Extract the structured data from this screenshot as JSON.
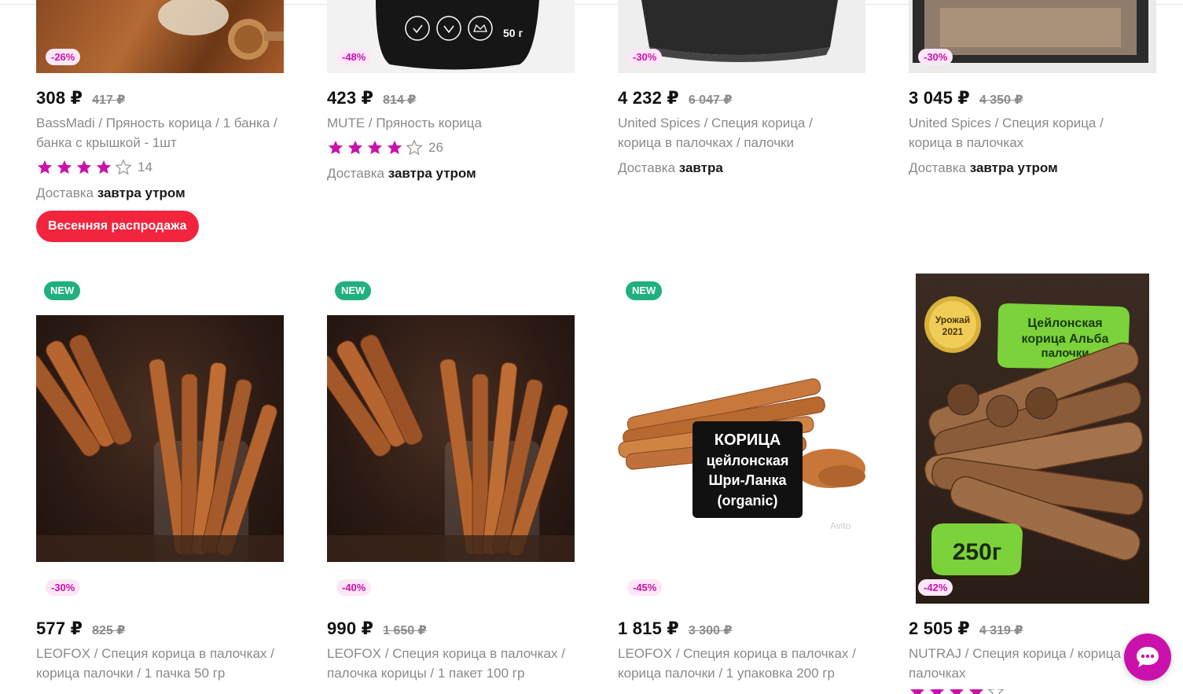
{
  "colors": {
    "accent": "#cb11ab",
    "new_badge": "#1fb07e",
    "promo": "#f3243e",
    "discount_bg": "#fde7f6"
  },
  "row1": [
    {
      "discount": "-26%",
      "price": "308 ₽",
      "old_price": "417 ₽",
      "brand": "BassMadi",
      "name": " / Пряность корица / 1 банка / банка с крышкой - 1шт",
      "rating_count": "14",
      "stars": 4,
      "delivery_prefix": "Доставка",
      "delivery_when": "завтра утром",
      "promo": "Весенняя распродажа"
    },
    {
      "discount": "-48%",
      "price": "423 ₽",
      "old_price": "814 ₽",
      "brand": "MUTE",
      "name": " / Пряность корица",
      "rating_count": "26",
      "stars": 4,
      "delivery_prefix": "Доставка",
      "delivery_when": "завтра утром",
      "pack_label": "50 г"
    },
    {
      "discount": "-30%",
      "price": "4 232 ₽",
      "old_price": "6 047 ₽",
      "brand": "United Spices",
      "name": " / Специя корица / корица в палочках / палочки",
      "delivery_prefix": "Доставка",
      "delivery_when": "завтра"
    },
    {
      "discount": "-30%",
      "price": "3 045 ₽",
      "old_price": "4 350 ₽",
      "brand": "United Spices",
      "name": " / Специя корица / корица в палочках",
      "delivery_prefix": "Доставка",
      "delivery_when": "завтра утром"
    }
  ],
  "row2": [
    {
      "new": "NEW",
      "discount": "-30%",
      "price": "577 ₽",
      "old_price": "825 ₽",
      "brand": "LEOFOX",
      "name": " / Специя корица в палочках / корица палочки / 1 пачка 50 гр"
    },
    {
      "new": "NEW",
      "discount": "-40%",
      "price": "990 ₽",
      "old_price": "1 650 ₽",
      "brand": "LEOFOX",
      "name": " / Специя корица в палочках / палочка корицы / 1 пакет 100 гр"
    },
    {
      "new": "NEW",
      "discount": "-45%",
      "price": "1 815 ₽",
      "old_price": "3 300 ₽",
      "brand": "LEOFOX",
      "name": " / Специя корица в палочках / корица палочки / 1 упаковка 200 гр",
      "img_text": [
        "КОРИЦА",
        "цейлонская",
        "Шри-Ланка",
        "(organic)"
      ],
      "watermark": "Avito"
    },
    {
      "discount": "-42%",
      "price": "2 505 ₽",
      "old_price": "4 319 ₽",
      "brand": "NUTRAJ",
      "name": " / Специя корица / корица палочках",
      "img_title": [
        "Цейлонская",
        "корица Альба",
        "палочки"
      ],
      "img_seal": [
        "Урожай",
        "2021"
      ],
      "img_weight": "250г"
    }
  ]
}
